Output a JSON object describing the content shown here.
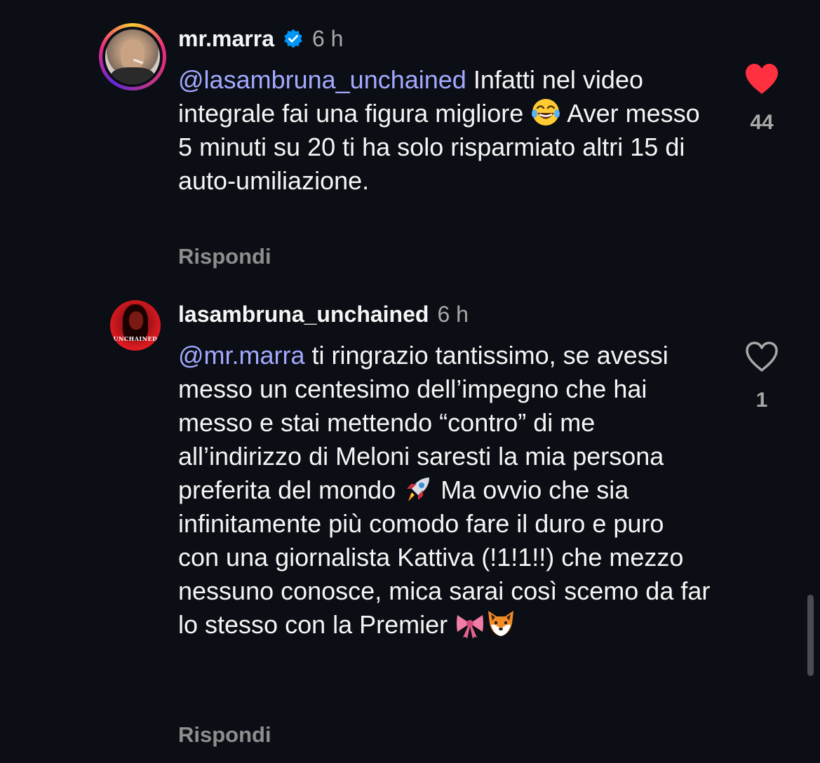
{
  "comments": [
    {
      "username": "mr.marra",
      "verified": true,
      "time": "6 h",
      "mention": "@lasambruna_unchained",
      "text_1": " Infatti nel video integrale fai una figura migliore ",
      "emoji_1": "face-with-tears-of-joy",
      "text_2": " Aver messo 5 minuti su 20 ti ha solo risparmiato altri 15 di auto-umiliazione.",
      "liked": true,
      "likes": "44",
      "reply_label": "Rispondi"
    },
    {
      "username": "lasambruna_unchained",
      "verified": false,
      "time": "6 h",
      "avatar_text": "UNCHAINED",
      "mention": "@mr.marra",
      "text_1": " ti ringrazio tantissimo, se avessi messo un centesimo dell’impegno che hai messo e stai mettendo “contro” di me all’indirizzo di Meloni saresti la mia persona preferita del mondo ",
      "emoji_1": "rocket",
      "text_2": " Ma ovvio che sia infinitamente più comodo fare il duro e puro con una giornalista Kattiva (!1!1!!) che mezzo nessuno conosce, mica sarai così scemo da far lo stesso con la Premier ",
      "emoji_2": "ribbon",
      "emoji_3": "fox",
      "liked": false,
      "likes": "1",
      "reply_label": "Rispondi"
    }
  ],
  "colors": {
    "background": "#0b0e14",
    "mention": "#a3a9ff",
    "secondary": "#a8a8a8",
    "like_red": "#ff3040",
    "verified_blue": "#0095f6"
  }
}
